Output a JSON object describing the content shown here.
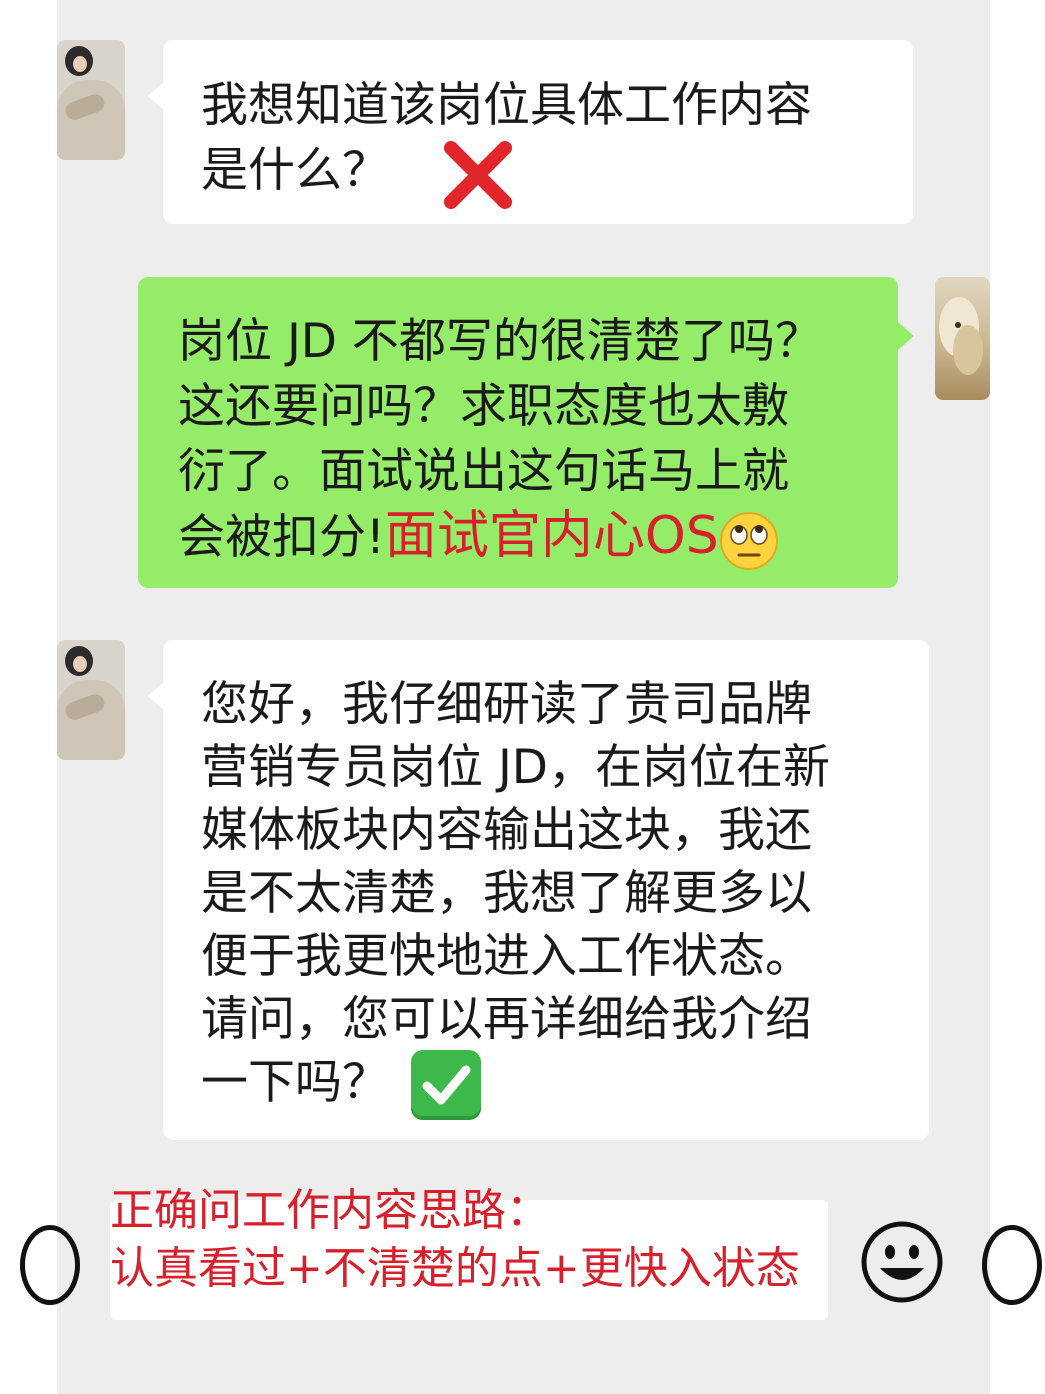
{
  "messages": {
    "q_wrong": {
      "lines": [
        "我想知道该岗位具体工作内容",
        "是什么？"
      ],
      "mark_icon": "red-x-icon"
    },
    "comment": {
      "lines": [
        "岗位 JD 不都写的很清楚了吗？",
        "这还要问吗？求职态度也太敷",
        "衍了。面试说出这句话马上就"
      ],
      "last_line": "会被扣分!",
      "red_label": "面试官内心OS",
      "emoji": "eye-roll-emoji"
    },
    "q_right": {
      "lines": [
        "您好，我仔细研读了贵司品牌",
        "营销专员岗位 JD，在岗位在新",
        "媒体板块内容输出这块，我还",
        "是不太清楚，我想了解更多以",
        "便于我更快地进入工作状态。",
        "请问，您可以再详细给我介绍"
      ],
      "last_line": "一下吗？",
      "mark_icon": "green-check-icon"
    }
  },
  "note": {
    "title": "正确问工作内容思路：",
    "body": "认真看过+不清楚的点+更快入状态"
  },
  "colors": {
    "chat_background": "#ededed",
    "white_bubble": "#ffffff",
    "green_bubble": "#95ec69",
    "accent_red": "#d8202c",
    "check_green": "#3cb94a"
  },
  "icons": [
    "voice-icon",
    "smile-icon",
    "plus-icon"
  ]
}
